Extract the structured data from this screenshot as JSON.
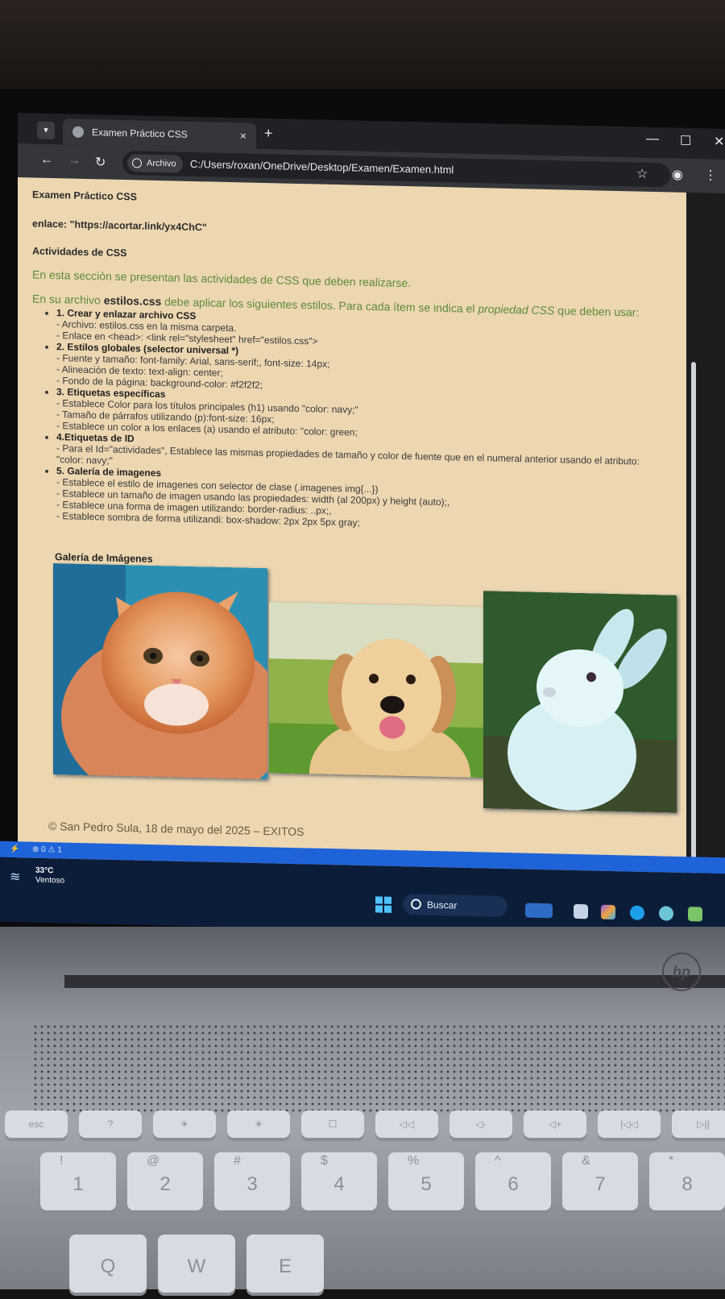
{
  "browser": {
    "tab_title": "Examen Práctico CSS",
    "tab_close": "×",
    "new_tab": "+",
    "origin_chip": "Archivo",
    "url": "C:/Users/roxan/OneDrive/Desktop/Examen/Examen.html"
  },
  "page": {
    "title": "Examen Práctico CSS",
    "link_line": "enlace: \"https://acortar.link/yx4ChC\"",
    "section_heading": "Actividades de CSS",
    "section_desc": "En esta sección se presentan las actividades de CSS que deben realizarse.",
    "intro": {
      "before": "En su archivo ",
      "file": "estilos.css",
      "middle": " debe aplicar los siguientes estilos. Para cada ítem se indica el ",
      "emph": "propiedad CSS",
      "after": " que deben usar:"
    },
    "activities": [
      {
        "title": "1. Crear y enlazar archivo CSS",
        "lines": [
          "- Archivo: estilos.css en la misma carpeta.",
          "- Enlace en <head>: <link rel=\"stylesheet\" href=\"estilos.css\">"
        ]
      },
      {
        "title": "2. Estilos globales (selector universal *)",
        "lines": [
          "- Fuente y tamaño: font-family: Arial, sans-serif;, font-size: 14px;",
          "- Alineación de texto: text-align: center;",
          "- Fondo de la página: background-color: #f2f2f2;"
        ]
      },
      {
        "title": "3. Etiquetas específicas",
        "lines": [
          "- Establece Color para los títulos principales (h1) usando \"color: navy;\"",
          "- Tamaño de párrafos utilizando (p):font-size: 16px;",
          "- Establece un color a los enlaces (a) usando el atributo: \"color: green;"
        ]
      },
      {
        "title": "4.Etiquetas de ID",
        "lines": [
          "- Para el Id=\"actividades\", Establece las mismas propiedades de tamaño y color de fuente que en el numeral anterior usando el atributo: \"color: navy;\""
        ]
      },
      {
        "title": "5. Galería de imagenes",
        "lines": [
          "- Establece el estilo de imagenes con selector de clase (.imagenes img{...})",
          "- Establece un tamaño de imagen usando las propiedades: width (al 200px) y height (auto);,",
          "- Establece una forma de imagen utilizando: border-radius: ..px;,",
          "- Establece sombra de forma utilizandi: box-shadow: 2px 2px 5px gray;"
        ]
      }
    ],
    "gallery_title": "Galería de Imágenes",
    "footer": "© San Pedro Sula, 18 de mayo del 2025 – EXITOS"
  },
  "statusbar": {
    "problems": "⊗ 0 ⚠ 1"
  },
  "taskbar": {
    "temperature": "33°C",
    "weather_desc": "Ventoso",
    "search_label": "Buscar"
  },
  "keyboard": {
    "fn_row": [
      "esc",
      "?",
      "☀",
      "☀",
      "☐",
      "◁◁",
      "◁-",
      "◁+",
      "|◁◁",
      "▷||"
    ],
    "num_row": [
      {
        "main": "1",
        "shift": "!"
      },
      {
        "main": "2",
        "shift": "@"
      },
      {
        "main": "3",
        "shift": "#"
      },
      {
        "main": "4",
        "shift": "$"
      },
      {
        "main": "5",
        "shift": "%"
      },
      {
        "main": "6",
        "shift": "^"
      },
      {
        "main": "7",
        "shift": "&"
      },
      {
        "main": "8",
        "shift": "*"
      }
    ],
    "letter_row": [
      "Q",
      "W",
      "E"
    ]
  },
  "colors": {
    "page_background": "#ecd7b1",
    "description_green": "#5f8a3a",
    "taskbar": "#0c1d3a",
    "statusbar": "#1f63d8"
  }
}
